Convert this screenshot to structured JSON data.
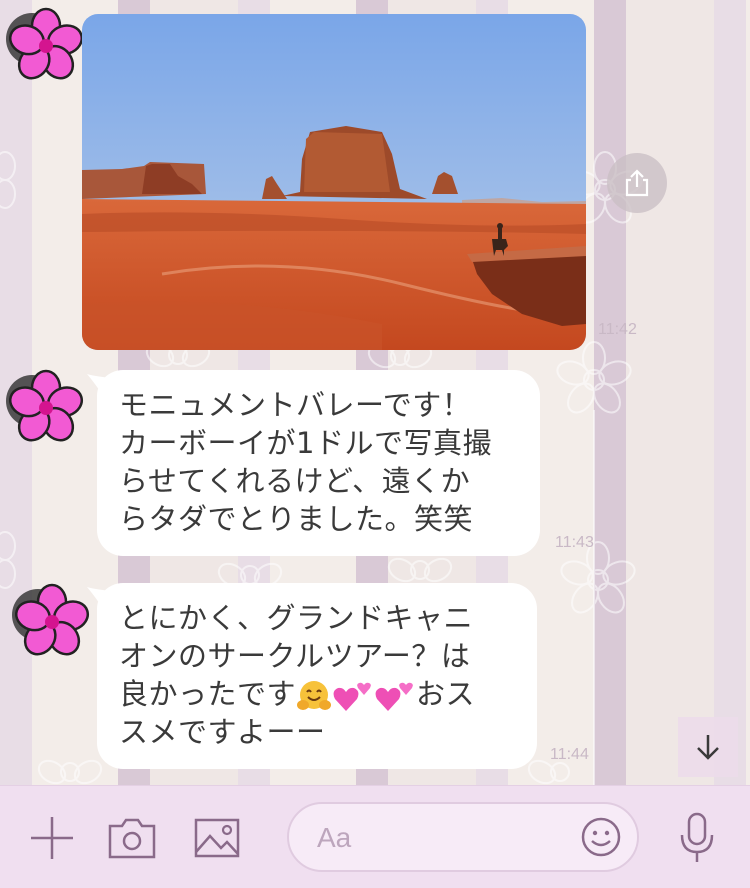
{
  "messages": [
    {
      "type": "image",
      "image_description": "Monument Valley red rock buttes with a cowboy on horseback on a cliff",
      "time": "11:42"
    },
    {
      "type": "text",
      "lines": [
        "モニュメントバレーです！",
        "カーボーイが1ドルで写真撮",
        "らせてくれるけど、遠くか",
        "らタダでとりました。笑笑"
      ],
      "time": "11:43"
    },
    {
      "type": "text",
      "lines": [
        "とにかく、グランドキャニ",
        "オンのサークルツアー？は",
        "良かったです",
        "おス",
        "スメですよーー"
      ],
      "time": "11:44"
    }
  ],
  "icons": {
    "avatar": "pink-flower-avatar",
    "share": "share-icon",
    "scroll_down": "arrow-down-icon",
    "add": "plus-icon",
    "camera": "camera-icon",
    "gallery": "image-icon",
    "emoji": "smiley-icon",
    "mic": "microphone-icon"
  },
  "input": {
    "placeholder": "Aa"
  },
  "colors": {
    "accent_pink": "#ee55c8",
    "footer_bg": "#f0dff0",
    "icon_purple": "#8a6a8a"
  }
}
